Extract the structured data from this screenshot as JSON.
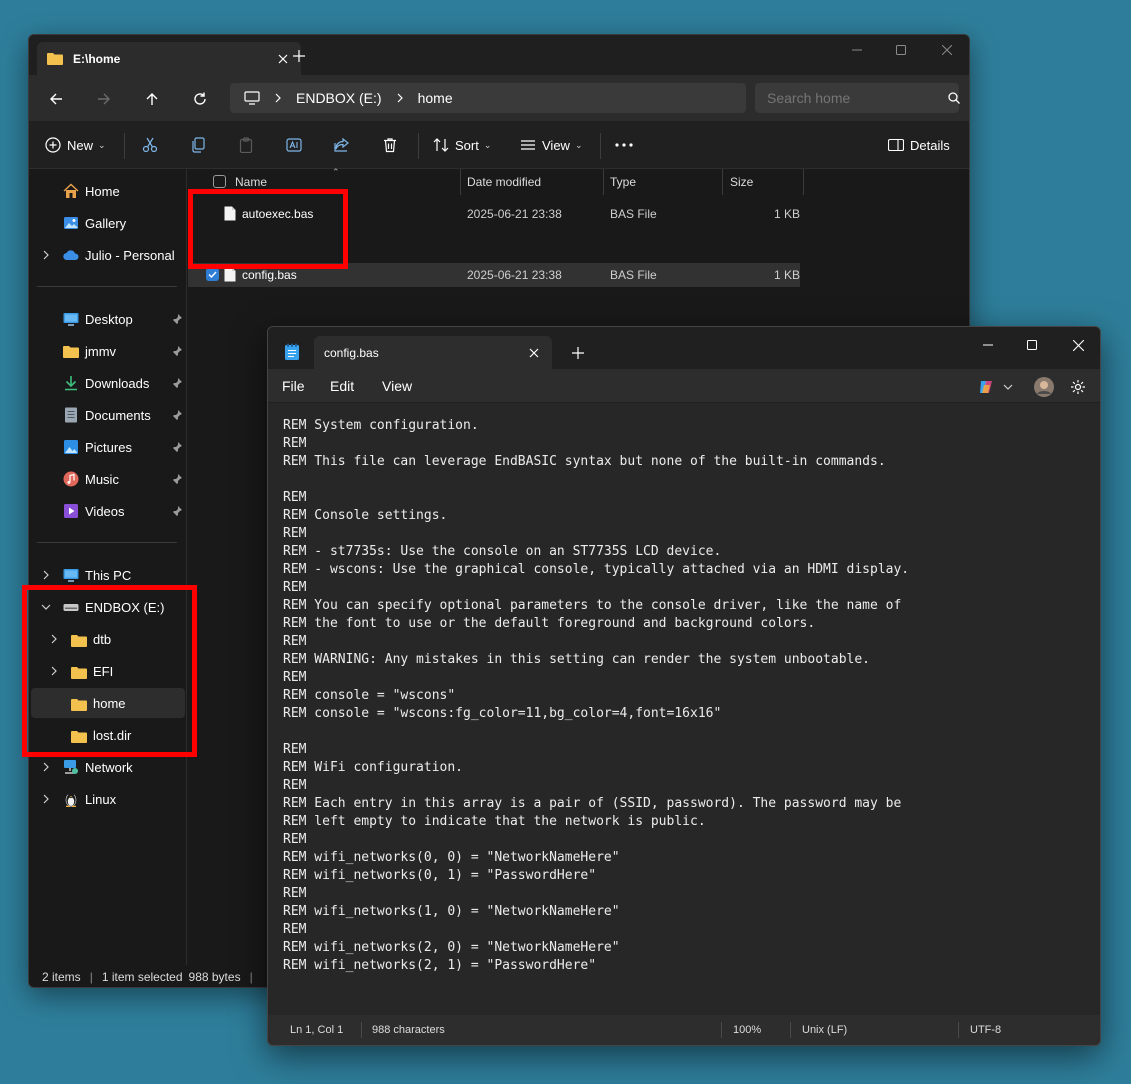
{
  "explorer": {
    "tab_title": "E:\\home",
    "breadcrumb": [
      "ENDBOX (E:)",
      "home"
    ],
    "search_placeholder": "Search home",
    "toolbar": {
      "new_label": "New",
      "sort_label": "Sort",
      "view_label": "View",
      "details_label": "Details"
    },
    "sidebar": {
      "home": "Home",
      "gallery": "Gallery",
      "onedrive": "Julio - Personal",
      "pinned": [
        "Desktop",
        "jmmv",
        "Downloads",
        "Documents",
        "Pictures",
        "Music",
        "Videos"
      ],
      "this_pc": "This PC",
      "drive": "ENDBOX (E:)",
      "drive_folders": [
        "dtb",
        "EFI",
        "home",
        "lost.dir"
      ],
      "network": "Network",
      "linux": "Linux"
    },
    "columns": [
      "Name",
      "Date modified",
      "Type",
      "Size"
    ],
    "files": [
      {
        "name": "autoexec.bas",
        "date": "2025-06-21 23:38",
        "type": "BAS File",
        "size": "1 KB",
        "selected": false
      },
      {
        "name": "config.bas",
        "date": "2025-06-21 23:38",
        "type": "BAS File",
        "size": "1 KB",
        "selected": true
      }
    ],
    "status": {
      "items": "2 items",
      "selection": "1 item selected",
      "bytes": "988 bytes"
    }
  },
  "notepad": {
    "tab_title": "config.bas",
    "menu": [
      "File",
      "Edit",
      "View"
    ],
    "content": "REM System configuration.\nREM\nREM This file can leverage EndBASIC syntax but none of the built-in commands.\n\nREM\nREM Console settings.\nREM\nREM - st7735s: Use the console on an ST7735S LCD device.\nREM - wscons: Use the graphical console, typically attached via an HDMI display.\nREM\nREM You can specify optional parameters to the console driver, like the name of\nREM the font to use or the default foreground and background colors.\nREM\nREM WARNING: Any mistakes in this setting can render the system unbootable.\nREM\nREM console = \"wscons\"\nREM console = \"wscons:fg_color=11,bg_color=4,font=16x16\"\n\nREM\nREM WiFi configuration.\nREM\nREM Each entry in this array is a pair of (SSID, password). The password may be\nREM left empty to indicate that the network is public.\nREM\nREM wifi_networks(0, 0) = \"NetworkNameHere\"\nREM wifi_networks(0, 1) = \"PasswordHere\"\nREM\nREM wifi_networks(1, 0) = \"NetworkNameHere\"\nREM\nREM wifi_networks(2, 0) = \"NetworkNameHere\"\nREM wifi_networks(2, 1) = \"PasswordHere\"",
    "status": {
      "position": "Ln 1, Col 1",
      "chars": "988 characters",
      "zoom": "100%",
      "line_endings": "Unix (LF)",
      "encoding": "UTF-8"
    }
  },
  "colors": {
    "desktop": "#2e7e9b",
    "highlight": "#ff0000",
    "accent": "#2f7ed6",
    "folder": "#f2c14e"
  }
}
